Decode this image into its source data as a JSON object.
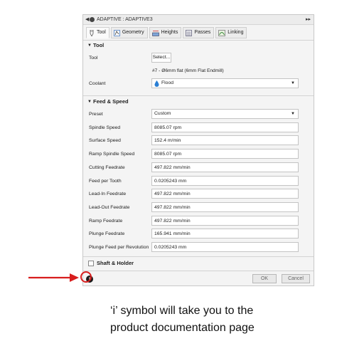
{
  "window": {
    "title": "ADAPTIVE : ADAPTIVE3",
    "collapse_glyph": "◀",
    "expand_glyph": "▸▸"
  },
  "tabs": [
    {
      "label": "Tool",
      "icon": "tool-icon",
      "active": true
    },
    {
      "label": "Geometry",
      "icon": "geometry-icon",
      "active": false
    },
    {
      "label": "Heights",
      "icon": "heights-icon",
      "active": false
    },
    {
      "label": "Passes",
      "icon": "passes-icon",
      "active": false
    },
    {
      "label": "Linking",
      "icon": "linking-icon",
      "active": false
    }
  ],
  "tool_section": {
    "title": "Tool",
    "tool_label": "Tool",
    "select_button": "Select...",
    "tool_description": "#7 - Ø6mm flat (6mm Flat Endmill)",
    "coolant_label": "Coolant",
    "coolant_value": "Flood"
  },
  "feed_section": {
    "title": "Feed & Speed",
    "preset_label": "Preset",
    "preset_value": "Custom",
    "rows": [
      {
        "label": "Spindle Speed",
        "value": "8085.07 rpm"
      },
      {
        "label": "Surface Speed",
        "value": "152.4 m/min"
      },
      {
        "label": "Ramp Spindle Speed",
        "value": "8085.07 rpm"
      },
      {
        "label": "Cutting Feedrate",
        "value": "497.822 mm/min"
      },
      {
        "label": "Feed per Tooth",
        "value": "0.0205243 mm"
      },
      {
        "label": "Lead-In Feedrate",
        "value": "497.822 mm/min"
      },
      {
        "label": "Lead-Out Feedrate",
        "value": "497.822 mm/min"
      },
      {
        "label": "Ramp Feedrate",
        "value": "497.822 mm/min"
      },
      {
        "label": "Plunge Feedrate",
        "value": "165.941 mm/min"
      },
      {
        "label": "Plunge Feed per Revolution",
        "value": "0.0205243 mm"
      }
    ]
  },
  "shaft_section": {
    "title": "Shaft & Holder"
  },
  "footer": {
    "ok": "OK",
    "cancel": "Cancel",
    "info_glyph": "i"
  },
  "caption": {
    "line1": "‘i’ symbol will take you to the",
    "line2": "product documentation page"
  },
  "colors": {
    "accent_red": "#d81e1e",
    "coolant_blue": "#2a7fd4"
  }
}
